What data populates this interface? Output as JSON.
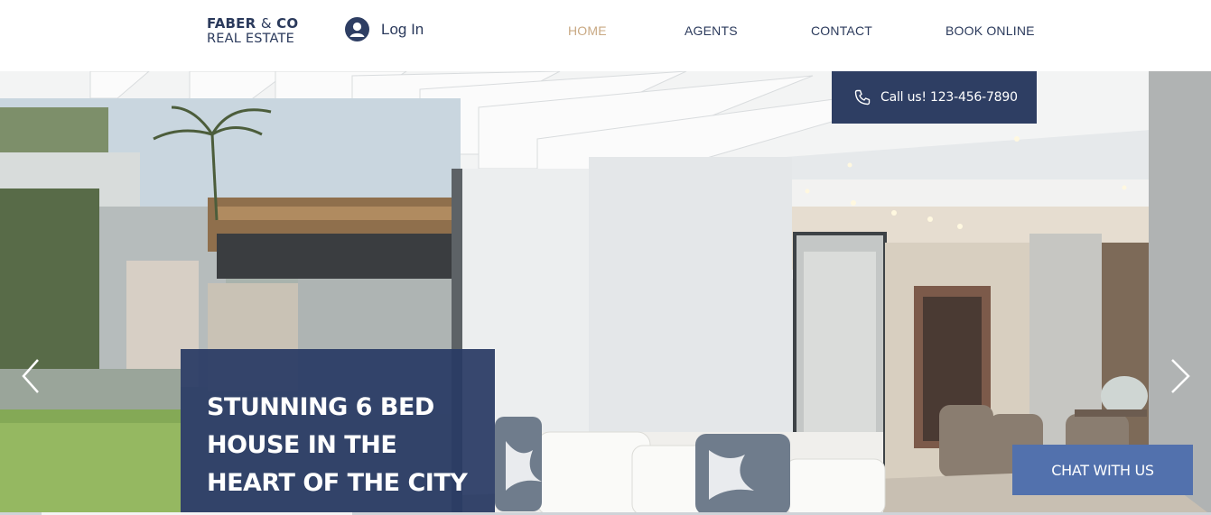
{
  "header": {
    "logo": {
      "line1_bold": "FABER",
      "line1_amp": "&",
      "line1_end": "CO",
      "line2": "REAL ESTATE"
    },
    "login": {
      "icon": "user-avatar-icon",
      "label": "Log In"
    },
    "nav": [
      {
        "label": "HOME",
        "active": true
      },
      {
        "label": "AGENTS",
        "active": false
      },
      {
        "label": "CONTACT",
        "active": false
      },
      {
        "label": "BOOK ONLINE",
        "active": false
      }
    ]
  },
  "hero": {
    "call": {
      "icon": "phone-icon",
      "label": "Call us! 123-456-7890"
    },
    "headline": "STUNNING 6 BED HOUSE IN THE HEART OF THE CITY",
    "prev_icon": "chevron-left-icon",
    "next_icon": "chevron-right-icon"
  },
  "chat": {
    "label": "CHAT WITH US"
  },
  "colors": {
    "brand_navy": "#2e3e63",
    "nav_active": "#c9a983",
    "chat_blue": "#5271ad",
    "text_navy": "#2b3a5c"
  }
}
